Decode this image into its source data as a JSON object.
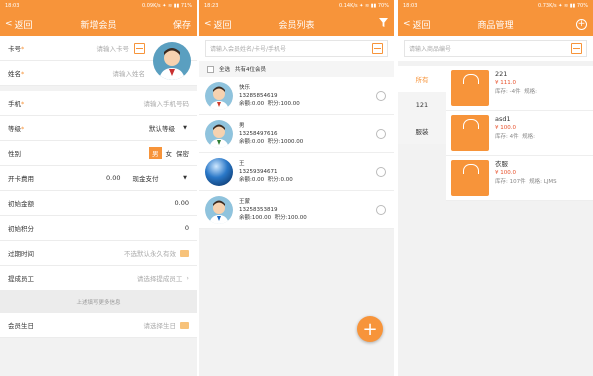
{
  "p1": {
    "status_time": "18:03",
    "status_right": "0.09K/s ✦ ≋ ▮▮ 71%",
    "back": "返回",
    "title": "新增会员",
    "save": "保存",
    "card_label": "卡号",
    "card_ph": "请输入卡号",
    "name_label": "姓名",
    "name_ph": "请输入姓名",
    "phone_label": "手机",
    "phone_ph": "请输入手机号码",
    "level_label": "等级",
    "level_value": "默认等级",
    "gender_label": "性别",
    "gender_male": "男",
    "gender_female": "女",
    "gender_secret": "保密",
    "fee_label": "开卡费用",
    "fee_value": "0.00",
    "pay_value": "现金支付",
    "init_amount_label": "初始金额",
    "init_amount_value": "0.00",
    "init_points_label": "初始积分",
    "init_points_value": "0",
    "expire_label": "过期时间",
    "expire_ph": "不选默认永久有效",
    "staff_label": "提成员工",
    "staff_ph": "请选择提成员工",
    "optional_hint": "上述填写更多信息",
    "birthday_label": "会员生日",
    "birthday_ph": "请选择生日"
  },
  "p2": {
    "status_time": "18:23",
    "status_right": "0.14K/s ✦ ≋ ▮▮ 70%",
    "back": "返回",
    "title": "会员列表",
    "search_ph": "请输入会员姓名/卡号/手机号",
    "select_all": "全选",
    "count_text": "共有4位会员",
    "members": [
      {
        "name": "快乐",
        "phone": "13285854619",
        "balance": "余额:0.00",
        "points": "积分:100.00"
      },
      {
        "name": "男",
        "phone": "13258497616",
        "balance": "余额:0.00",
        "points": "积分:1000.00"
      },
      {
        "name": "王",
        "phone": "13259394671",
        "balance": "余额:0.00",
        "points": "积分:0.00"
      },
      {
        "name": "王蒙",
        "phone": "13258353819",
        "balance": "余额:100.00",
        "points": "积分:100.00"
      }
    ],
    "fab": "+"
  },
  "p3": {
    "status_time": "18:03",
    "status_right": "0.73K/s ✦ ≋ ▮▮ 70%",
    "back": "返回",
    "title": "商品管理",
    "search_ph": "请输入商品编号",
    "categories": [
      "所有",
      "121",
      "服装"
    ],
    "goods": [
      {
        "name": "221",
        "price": "¥ 111.0",
        "stock": "库存: -4件",
        "spec": "规格:"
      },
      {
        "name": "asd1",
        "price": "¥ 100.0",
        "stock": "库存: 4件",
        "spec": "规格:"
      },
      {
        "name": "衣服",
        "price": "¥ 100.0",
        "stock": "库存: 107件",
        "spec": "规格: LJMS"
      }
    ]
  },
  "colors": {
    "accent": "#f7943a",
    "price": "#e8502a"
  }
}
